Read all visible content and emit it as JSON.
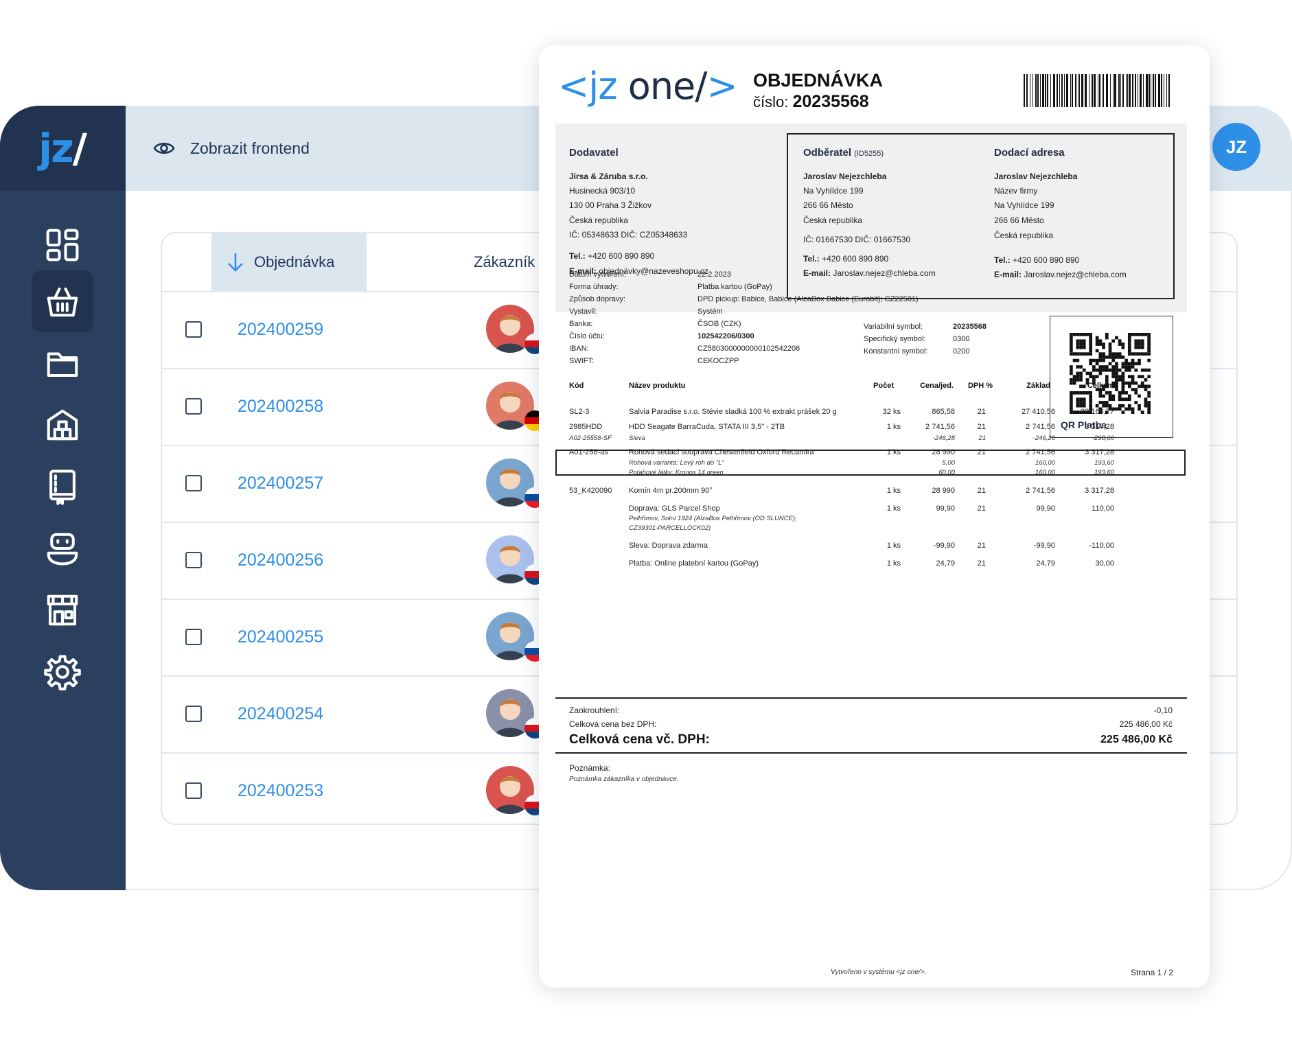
{
  "app": {
    "logo_text": "jz",
    "logo_slash": "/",
    "frontend_link": "Zobrazit frontend",
    "user_initials": "JZ",
    "nav": [
      {
        "icon": "dashboard-icon",
        "active": false
      },
      {
        "icon": "basket-icon",
        "active": true
      },
      {
        "icon": "folder-icon",
        "active": false
      },
      {
        "icon": "warehouse-icon",
        "active": false
      },
      {
        "icon": "catalog-book-icon",
        "active": false
      },
      {
        "icon": "robot-icon",
        "active": false
      },
      {
        "icon": "store-icon",
        "active": false
      },
      {
        "icon": "gear-icon",
        "active": false
      }
    ],
    "list": {
      "col_order": "Objednávka",
      "col_customer": "Zákazník",
      "rows": [
        {
          "order": "202400259",
          "face": "#d9534f",
          "flag": "cz"
        },
        {
          "order": "202400258",
          "face": "#e07a67",
          "flag": "de"
        },
        {
          "order": "202400257",
          "face": "#7aa5cf",
          "flag": "sk"
        },
        {
          "order": "202400256",
          "face": "#a9c1ec",
          "flag": "cz"
        },
        {
          "order": "202400255",
          "face": "#7aa5cf",
          "flag": "sk"
        },
        {
          "order": "202400254",
          "face": "#8a90a8",
          "flag": "cz"
        },
        {
          "order": "202400253",
          "face": "#d9534f",
          "flag": "cz"
        }
      ]
    },
    "colors": {
      "sidebar": "#2b3f5e",
      "accent": "#2e8fe6",
      "topbar": "#dce6ef"
    }
  },
  "doc": {
    "logo_open": "<",
    "logo_jz": "jz",
    "logo_one": " one",
    "logo_close": "/>",
    "title": "OBJEDNÁVKA",
    "number_label": "číslo:",
    "number": "20235568",
    "supplier": {
      "heading": "Dodavatel",
      "name": "Jirsa & Záruba s.r.o.",
      "street": "Husinecká 903/10",
      "city": "130 00 Praha 3 Žižkov",
      "country": "Česká republika",
      "ids": "IČ: 05348633 DIČ: CZ05348633",
      "tel_label": "Tel.:",
      "tel": "+420 600 890 890",
      "email_label": "E-mail:",
      "email": "objednávky@nazeveshopu.cz"
    },
    "customer": {
      "heading": "Odběratel",
      "id": "(ID5255)",
      "name": "Jaroslav Nejezchleba",
      "street": "Na Vyhlídce 199",
      "city": "266 66 Město",
      "country": "Česká republika",
      "ids": "IČ: 01667530  DIČ: 01667530",
      "tel_label": "Tel.:",
      "tel": "+420 600 890 890",
      "email_label": "E-mail:",
      "email": "Jaroslav.nejez@chleba.com"
    },
    "delivery": {
      "heading": "Dodací adresa",
      "name": "Jaroslav Nejezchleba",
      "company": "Název firmy",
      "street": "Na Vyhlídce 199",
      "city": "266 66 Město",
      "country": "Česká republika",
      "tel_label": "Tel.:",
      "tel": "+420 600 890 890",
      "email_label": "E-mail:",
      "email": "Jaroslav.nejez@chleba.com"
    },
    "info": [
      {
        "label": "Datum vytvoření:",
        "value": "22.2.2023"
      },
      {
        "label": "Forma úhrady:",
        "value": "Platba kartou (GoPay)"
      },
      {
        "label": "Způsob dopravy:",
        "value": "DPD pickup: Babice, Babice (AlzaBox Babice (Eurobit); CZ22581)"
      },
      {
        "label": "Vystavil:",
        "value": "Systém"
      },
      {
        "label": "Banka:",
        "value": "ČSOB (CZK)"
      },
      {
        "label": "Číslo účtu:",
        "value": "102542206/0300"
      },
      {
        "label": "IBAN:",
        "value": "CZ5803000000000102542206"
      },
      {
        "label": "SWIFT:",
        "value": "CEKOCZPP"
      }
    ],
    "symbols": [
      {
        "label": "Variabilní symbol:",
        "value": "20235568"
      },
      {
        "label": "Specifický symbol:",
        "value": "0300"
      },
      {
        "label": "Konstantní symbol:",
        "value": "0200"
      }
    ],
    "qr_label": "QR Platba",
    "table_head": [
      "Kód",
      "Název produktu",
      "Počet",
      "Cena/jed.",
      "DPH %",
      "Základ",
      "Celkem"
    ],
    "items": [
      {
        "code": "SL2-3",
        "name": "Salvia Paradise s.r.o. Stévie sladká 100 % extrakt prášek 20 g",
        "qty": "32 ks",
        "price": "865,58",
        "vat": "21",
        "base": "27 410,56",
        "total": "33 166,77"
      },
      {
        "code": "2985HDD",
        "name": "HDD Seagate BarraCuda, STATA III 3,5\" - 2TB",
        "qty": "1 ks",
        "price": "2 741,56",
        "vat": "21",
        "base": "2 741,56",
        "total": "3 317,28"
      },
      {
        "code": "A01-258-as",
        "name": "Rohová sedací souprava Chesterfield Oxford Recamira",
        "qty": "1 ks",
        "price": "28 990",
        "vat": "21",
        "base": "2 741,56",
        "total": "3 317,28"
      },
      {
        "code": "53_K420090",
        "name": "Komín 4m pr.200mm 90°",
        "qty": "1 ks",
        "price": "28 990",
        "vat": "21",
        "base": "2 741,56",
        "total": "3 317,28"
      },
      {
        "code": "",
        "name": "Doprava: GLS Parcel Shop",
        "qty": "1 ks",
        "price": "99,90",
        "vat": "21",
        "base": "99,90",
        "total": "110,00"
      },
      {
        "code": "",
        "name": "Sleva: Doprava zdarma",
        "qty": "1 ks",
        "price": "-99,90",
        "vat": "21",
        "base": "-99,90",
        "total": "-110,00"
      },
      {
        "code": "",
        "name": "Platba: Online platební kartou (GoPay)",
        "qty": "1 ks",
        "price": "24,79",
        "vat": "21",
        "base": "24,79",
        "total": "30,00"
      }
    ],
    "subitems": {
      "discount": {
        "code": "A02-25558-SF",
        "name": "Sleva",
        "price": "-246,28",
        "vat": "21",
        "base": "-246,28",
        "total": "-298,60"
      },
      "variant1": {
        "name": "Rohová varianta: Levý roh do \"L\"",
        "price": "5,00",
        "base": "160,00",
        "total": "193,60"
      },
      "variant2": {
        "name": "Potahové látky: Kronos 14 green",
        "price": "60,00",
        "base": "160,00",
        "total": "193,60"
      },
      "shipping_note1": "Pelhřimov, Solní 1924 (AlzaBox Pelhřimov (OD SLUNCE);",
      "shipping_note2": "CZ39301-PARCELLOCK02)"
    },
    "totals": {
      "rounding_label": "Zaokrouhlení:",
      "rounding": "-0,10",
      "net_label": "Celková cena bez DPH:",
      "net": "225 486,00 Kč",
      "gross_label": "Celková cena vč. DPH:",
      "gross": "225 486,00 Kč"
    },
    "note_label": "Poznámka:",
    "note": "Poznámka zákazníka v objednávce.",
    "footer_created": "Vytvořeno v systému <jz one/>.",
    "footer_page": "Strana 1 / 2"
  }
}
